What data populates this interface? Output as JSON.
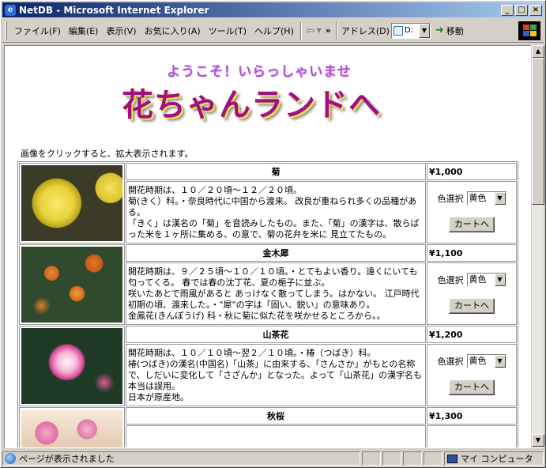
{
  "window": {
    "title": "NetDB - Microsoft Internet Explorer"
  },
  "menu": [
    "ファイル(F)",
    "編集(E)",
    "表示(V)",
    "お気に入り(A)",
    "ツール(T)",
    "ヘルプ(H)"
  ],
  "address": {
    "label": "アドレス(D)",
    "value": "D:",
    "go_label": "移動"
  },
  "page": {
    "welcome": "ようこそ！いらっしゃいませ",
    "banner": "花ちゃんランドへ",
    "hint": "画像をクリックすると、拡大表示されます。"
  },
  "products": [
    {
      "name": "菊",
      "price": "¥1,000",
      "lines": [
        "開花時期は、１０／２０頃〜１２／２０頃。",
        "菊(きく）科。・奈良時代に中国から渡来。 改良が重ねられ多くの品種がある。",
        "「きく」は漢名の「菊」を音読みしたもの。また、「菊」の漢字は、散らばった米を１ヶ所に集める、の意で、菊の花弁を米に 見立てたもの。"
      ],
      "color_label": "色選択",
      "color_value": "黄色",
      "cart_label": "カートへ",
      "photo": "yellow-chrysanthemum"
    },
    {
      "name": "金木犀",
      "price": "¥1,100",
      "lines": [
        "開花時期は、９／２５頃〜１０／１０頃。・とてもよい香り。遠くにいても匂ってくる。 春では春の沈丁花、夏の梔子に並ぶ。",
        "咲いたあとで雨風があると あっけなく散ってしまう。はかない。 江戸時代初期の頃、渡来した。・\"犀\"の字は「固い、鋭い」の意味あり。",
        "金鳳花(きんぽうげ) 科・秋に菊に似た花を咲かせるところから。。"
      ],
      "color_label": "色選択",
      "color_value": "黄色",
      "cart_label": "カートへ",
      "photo": "osmanthus"
    },
    {
      "name": "山茶花",
      "price": "¥1,200",
      "lines": [
        "開花時期は、１０／１０頃〜翌２／１０頃。・椿（つばき）科。",
        "椿(つばき)の漢名(中国名)「山茶」に由来する、「さんさか」がもとの名称で、しだいに変化して「さざんか」となった。よって「山茶花」の漢字名も本当は誤用。",
        "日本が原産地。"
      ],
      "color_label": "色選択",
      "color_value": "黄色",
      "cart_label": "カートへ",
      "photo": "sasanqua"
    },
    {
      "name": "秋桜",
      "price": "¥1,300",
      "lines": [],
      "photo": "cosmos"
    }
  ],
  "status": {
    "text": "ページが表示されました",
    "zone": "マイ コンピュータ"
  },
  "colors": {
    "title_start": "#0a246a",
    "title_end": "#a6caf0",
    "banner": "#a0107f",
    "welcome": "#b14fd8"
  }
}
